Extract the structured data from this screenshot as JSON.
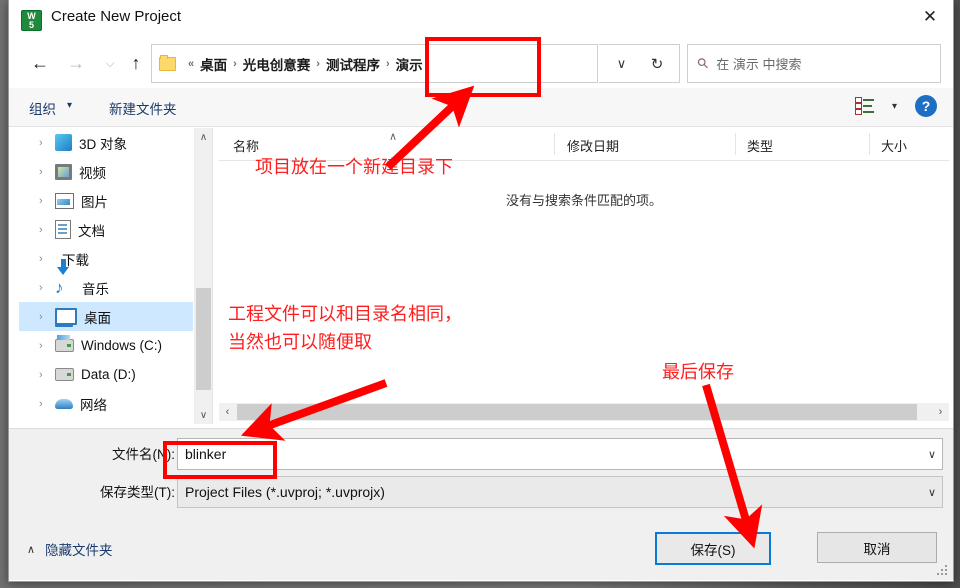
{
  "window": {
    "title": "Create New Project",
    "app_icon": "keil-uvision-icon",
    "close_label": "✕"
  },
  "nav": {
    "back": "←",
    "forward": "→",
    "recent": "⌵",
    "up": "↑",
    "breadcrumb_prefix": "«",
    "breadcrumb": [
      "桌面",
      "光电创意赛",
      "测试程序",
      "演示"
    ],
    "separator": "›",
    "path_dropdown": "∨",
    "refresh": "↻",
    "search_placeholder": "在 演示 中搜索",
    "search_icon": "search-icon"
  },
  "commandbar": {
    "organize": "组织",
    "organize_caret": "▾",
    "new_folder": "新建文件夹",
    "view_caret": "▾",
    "help": "?"
  },
  "tree": {
    "items": [
      {
        "label": "3D 对象",
        "icon": "3d-objects-icon",
        "selected": false
      },
      {
        "label": "视频",
        "icon": "videos-icon",
        "selected": false
      },
      {
        "label": "图片",
        "icon": "pictures-icon",
        "selected": false
      },
      {
        "label": "文档",
        "icon": "documents-icon",
        "selected": false
      },
      {
        "label": "下载",
        "icon": "downloads-icon",
        "selected": false
      },
      {
        "label": "音乐",
        "icon": "music-icon",
        "selected": false
      },
      {
        "label": "桌面",
        "icon": "desktop-icon",
        "selected": true
      },
      {
        "label": "Windows (C:)",
        "icon": "system-drive-icon",
        "selected": false
      },
      {
        "label": "Data (D:)",
        "icon": "drive-icon",
        "selected": false
      },
      {
        "label": "网络",
        "icon": "network-icon",
        "selected": false
      }
    ],
    "expand_chevron": "›",
    "scroll_up": "∧",
    "scroll_down": "∨"
  },
  "filelist": {
    "columns": [
      "名称",
      "修改日期",
      "类型",
      "大小"
    ],
    "sort_indicator": "∧",
    "empty_message": "没有与搜索条件匹配的项。",
    "scroll_left": "‹",
    "scroll_right": "›"
  },
  "form": {
    "filename_label": "文件名(N):",
    "filename_value": "blinker",
    "filetype_label": "保存类型(T):",
    "filetype_value": "Project Files (*.uvproj; *.uvprojx)",
    "dropdown_caret": "∨"
  },
  "footer": {
    "hide_folders": "隐藏文件夹",
    "hide_caret": "∧",
    "save_label": "保存(S)",
    "cancel_label": "取消"
  },
  "annotations": {
    "color": "#ff1d1d",
    "note_new_dir": "项目放在一个新建目录下",
    "note_project_name_line1": "工程文件可以和目录名相同，",
    "note_project_name_line2": "当然也可以随便取",
    "note_save_last": "最后保存"
  }
}
